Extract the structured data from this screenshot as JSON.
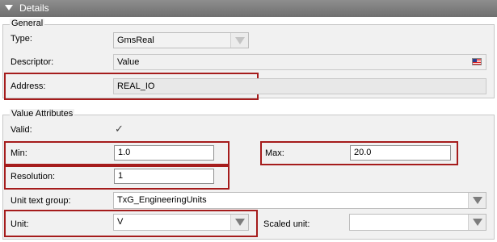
{
  "header": {
    "title": "Details"
  },
  "general": {
    "legend": "General",
    "type_label": "Type:",
    "type_value": "GmsReal",
    "descriptor_label": "Descriptor:",
    "descriptor_value": "Value",
    "address_label": "Address:",
    "address_value": "REAL_IO"
  },
  "value_attributes": {
    "legend": "Value Attributes",
    "valid_label": "Valid:",
    "valid_checked": true,
    "min_label": "Min:",
    "min_value": "1.0",
    "max_label": "Max:",
    "max_value": "20.0",
    "resolution_label": "Resolution:",
    "resolution_value": "1",
    "unit_text_group_label": "Unit text group:",
    "unit_text_group_value": "TxG_EngineeringUnits",
    "unit_label": "Unit:",
    "unit_value": "V",
    "scaled_unit_label": "Scaled unit:",
    "scaled_unit_value": ""
  },
  "check_glyph": "✓",
  "colors": {
    "highlight": "#a51c1c",
    "header_bg": "#7f7f7f",
    "panel_bg": "#f1f1f1"
  },
  "icons": {
    "collapse": "triangle-down-icon",
    "language": "us-flag-icon",
    "dropdown": "chevron-down-icon"
  }
}
